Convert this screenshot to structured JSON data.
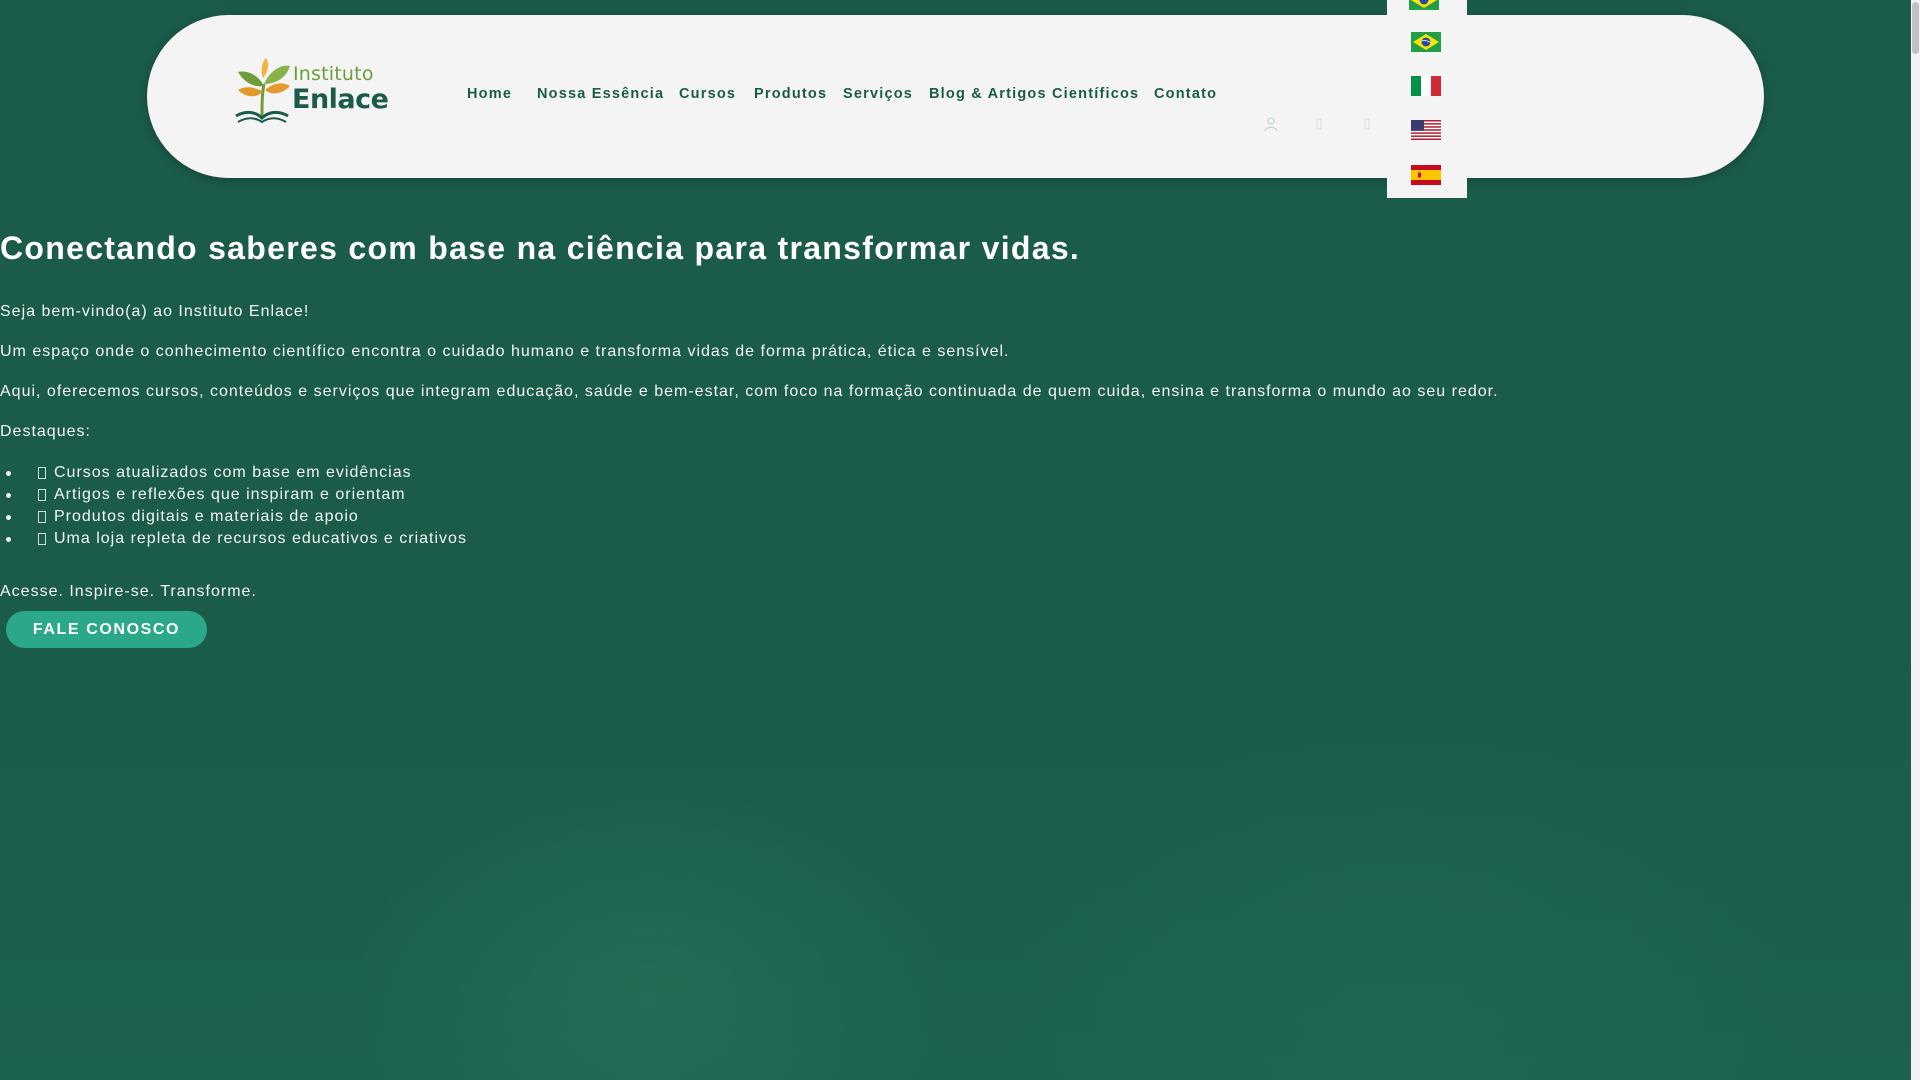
{
  "brand": {
    "line1": "Instituto",
    "line2": "Enlace",
    "colors": {
      "primary": "#1b5b49",
      "leaf": "#6d9d3b",
      "accent": "#2aa889",
      "orange": "#e39a2c"
    }
  },
  "nav": {
    "items": [
      {
        "label": "Home"
      },
      {
        "label": "Nossa Essência"
      },
      {
        "label": "Cursos"
      },
      {
        "label": "Produtos"
      },
      {
        "label": "Serviços"
      },
      {
        "label": "Blog & Artigos Científicos"
      },
      {
        "label": "Contato"
      }
    ]
  },
  "header_icons": [
    "user-icon",
    "search-icon",
    "cart-icon"
  ],
  "languages": [
    {
      "name": "Português (Brasil)",
      "flag": "brazil-flag-icon"
    },
    {
      "name": "Português",
      "flag": "brazil-flag-icon"
    },
    {
      "name": "Italiano",
      "flag": "italy-flag-icon"
    },
    {
      "name": "English",
      "flag": "usa-flag-icon"
    },
    {
      "name": "Español",
      "flag": "spain-flag-icon"
    }
  ],
  "hero": {
    "title": "Conectando saberes com base na ciência para transformar vidas.",
    "welcome": "Seja bem-vindo(a) ao Instituto Enlace!",
    "intro": "Um espaço onde o conhecimento científico encontra o cuidado humano e transforma vidas de forma prática, ética e sensível.",
    "offer": "Aqui, oferecemos cursos, conteúdos e serviços que integram educação, saúde e bem-estar, com foco na formação continuada de quem cuida, ensina e transforma o mundo ao seu redor.",
    "highlights_label": "Destaques:",
    "highlights": [
      "Cursos atualizados com base em evidências",
      "Artigos e reflexões que inspiram e orientam",
      "Produtos digitais e materiais de apoio",
      "Uma loja repleta de recursos educativos e criativos"
    ],
    "tagline": "Acesse. Inspire-se. Transforme.",
    "cta_label": "FALE CONOSCO"
  }
}
